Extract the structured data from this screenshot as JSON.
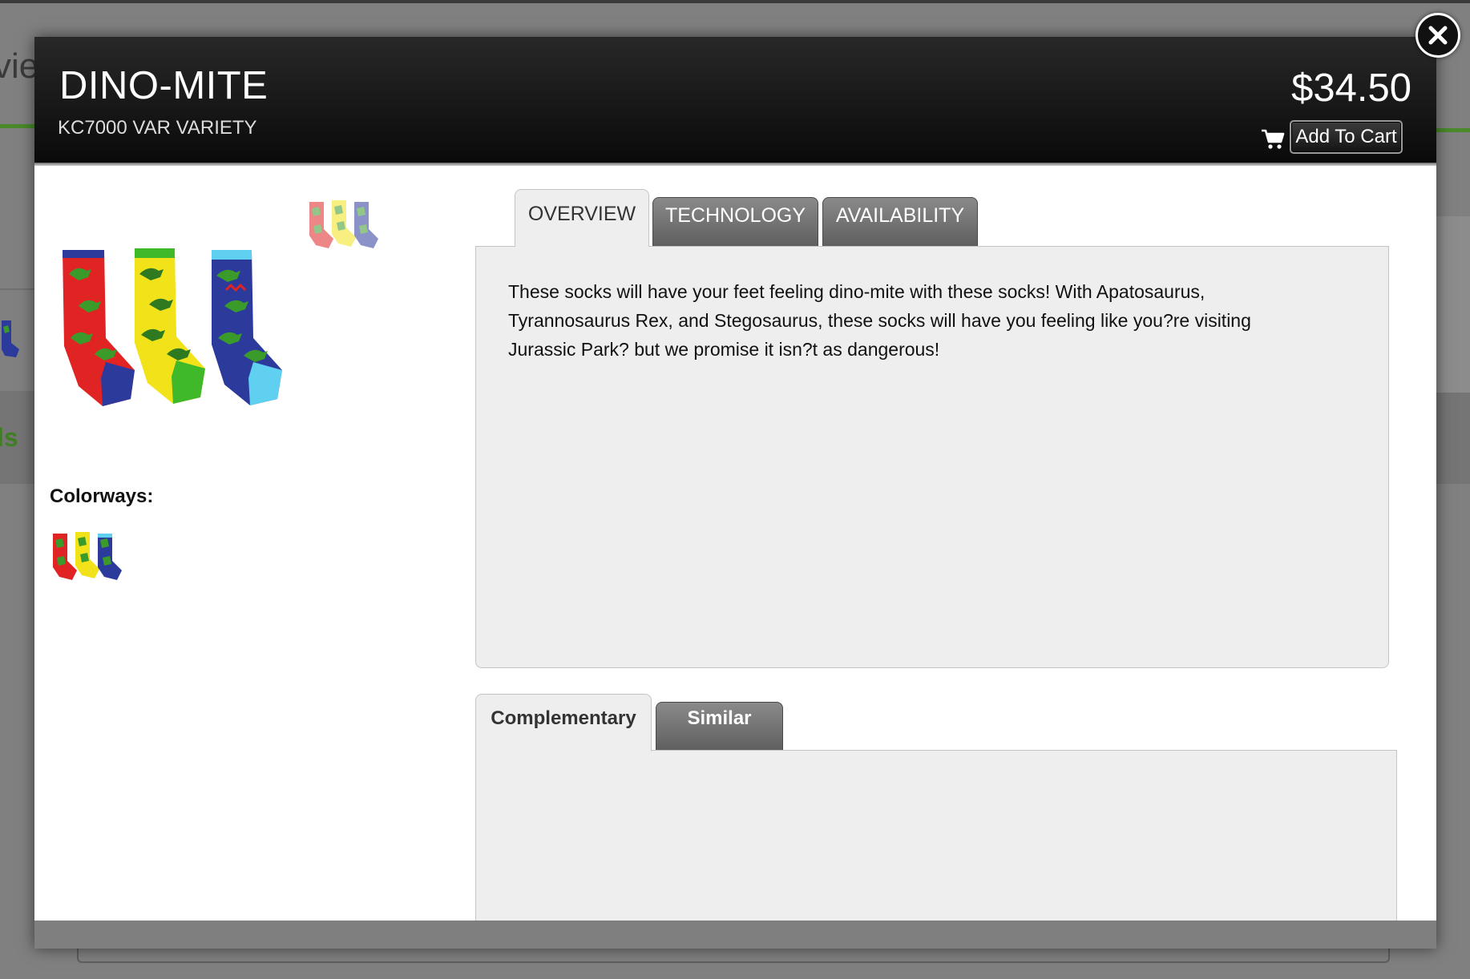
{
  "background": {
    "left_fragment_text": "vie",
    "left_green_fragment_text": "ls"
  },
  "product": {
    "title": "DINO-MITE",
    "sku": "KC7000 VAR VARIETY",
    "price": "$34.50"
  },
  "actions": {
    "add_to_cart_label": "Add To Cart"
  },
  "images": {
    "colorways_label": "Colorways:"
  },
  "tabs": [
    {
      "label": "OVERVIEW",
      "active": true
    },
    {
      "label": "TECHNOLOGY",
      "active": false
    },
    {
      "label": "AVAILABILITY",
      "active": false
    }
  ],
  "overview": {
    "text": "These socks will have your feet feeling dino-mite with these socks! With Apatosaurus, Tyrannosaurus Rex, and Stegosaurus, these socks will have you feeling like you?re visiting Jurassic Park? but we promise it isn?t as dangerous!"
  },
  "related_tabs": [
    {
      "label": "Complementary",
      "active": true
    },
    {
      "label": "Similar",
      "active": false
    }
  ],
  "colors": {
    "header_bg": "#0a0a0a",
    "tab_active_bg": "#eeeeee",
    "tab_inactive_bg": "#6e6e6e",
    "sock_red": "#e02424",
    "sock_yellow": "#f2e21a",
    "sock_blue": "#2c3a9c",
    "dino_green": "#3a9a2a",
    "accent_green": "#4a8a2a"
  }
}
